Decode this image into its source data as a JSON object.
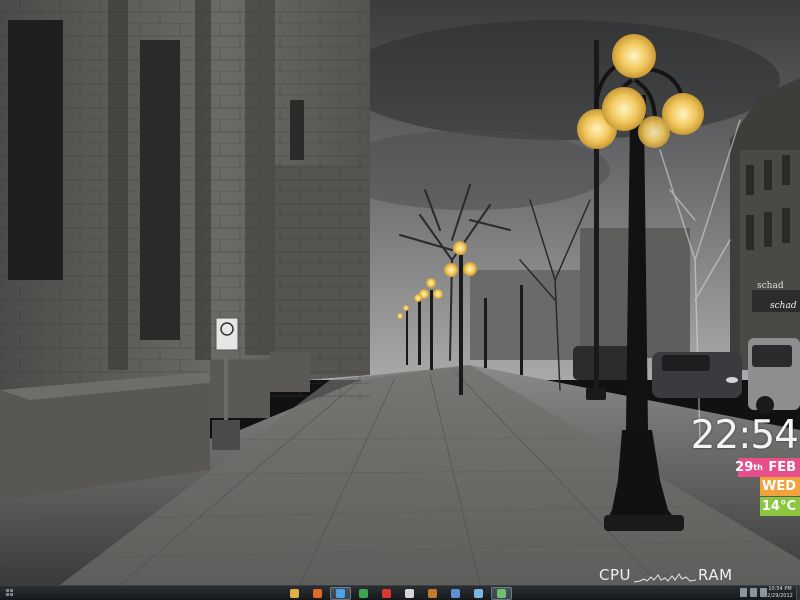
{
  "widget": {
    "time": "22:54",
    "date_day": "29",
    "date_suffix": "th",
    "date_month": "FEB",
    "weekday": "WED",
    "temperature": "14°C",
    "colors": {
      "date": "#e84f8a",
      "weekday": "#f0a23c",
      "temp": "#8cc63f"
    }
  },
  "sysmon": {
    "cpu_label": "CPU",
    "ram_label": "RAM"
  },
  "street": {
    "shop_sign": "schad"
  },
  "taskbar": {
    "icons": [
      {
        "name": "folder-icon",
        "color": "#e0b040"
      },
      {
        "name": "media-player-icon",
        "color": "#e06b2a"
      },
      {
        "name": "browser-icon",
        "color": "#4aa3e8",
        "active": true
      },
      {
        "name": "spreadsheet-icon",
        "color": "#3fa552"
      },
      {
        "name": "pdf-reader-icon",
        "color": "#d63a2f"
      },
      {
        "name": "paint-icon",
        "color": "#d6d6d6"
      },
      {
        "name": "archive-icon",
        "color": "#c07a30"
      },
      {
        "name": "network-icon",
        "color": "#5b8fd6"
      },
      {
        "name": "app-icon",
        "color": "#7ab4e0"
      },
      {
        "name": "terminal-icon",
        "color": "#6ec16e",
        "active": true
      }
    ],
    "clock_time": "10:54 PM",
    "clock_date": "2/29/2012"
  }
}
